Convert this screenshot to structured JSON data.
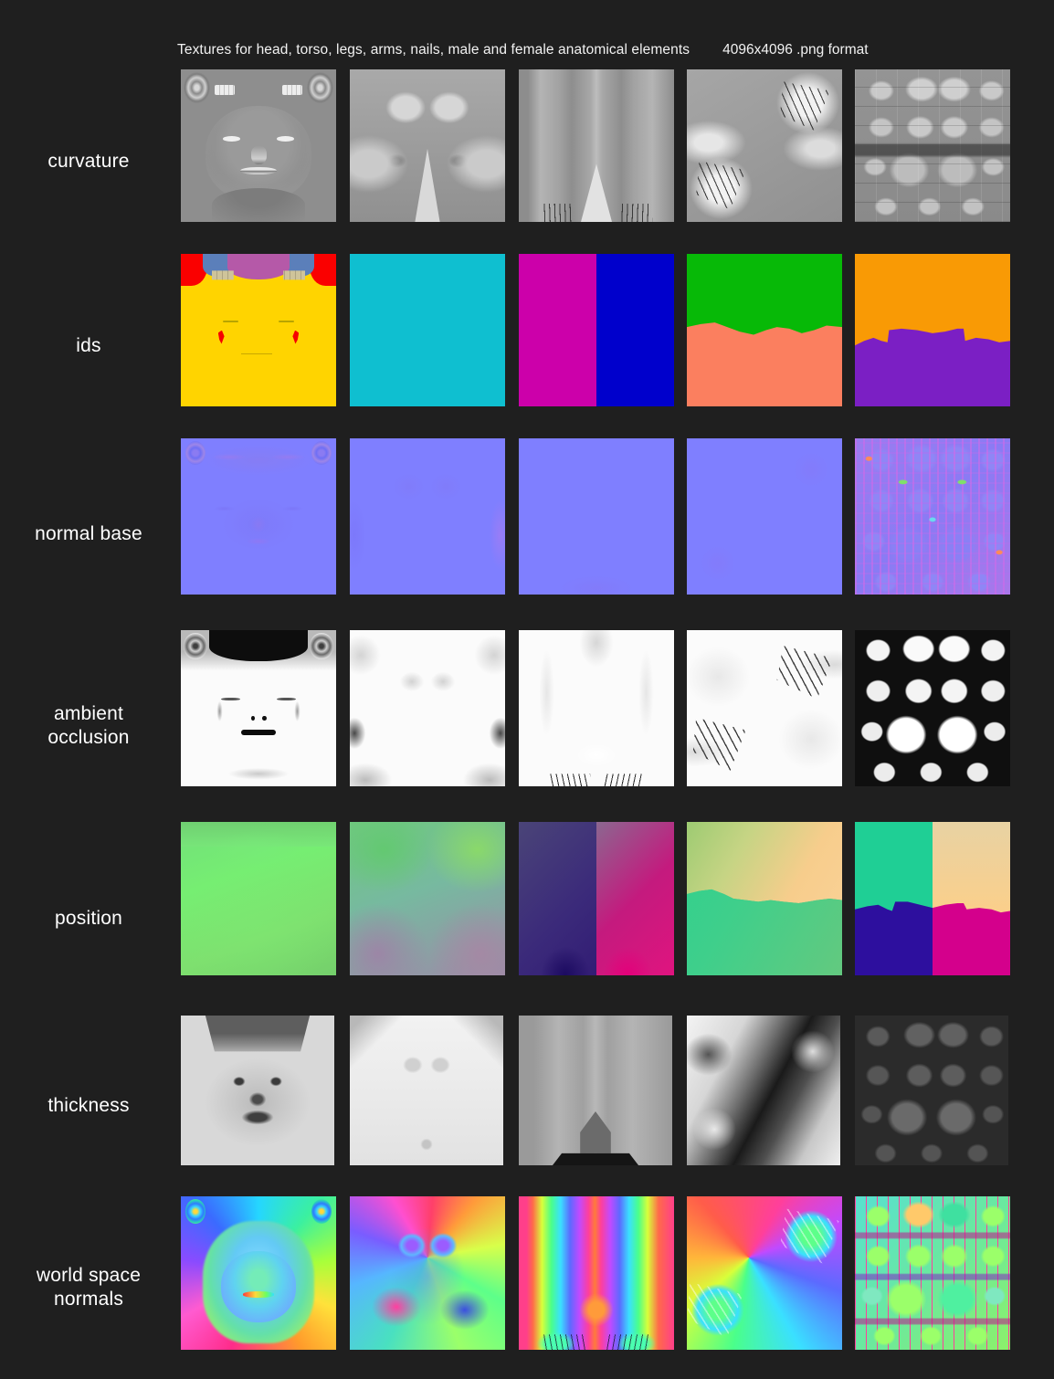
{
  "background_color": "#1f1f1f",
  "header": {
    "title": "Textures for head, torso, legs, arms, nails, male and female anatomical elements",
    "meta": "4096x4096 .png format"
  },
  "grid": {
    "column_subjects": [
      "head",
      "torso",
      "legs",
      "arms and hands",
      "nails"
    ],
    "rows": [
      {
        "label": "curvature",
        "kind": "grayscale-curvature",
        "thumbnails": [
          {
            "subject": "head",
            "description": "grayscale curvature map of a face with ears and teeth at top"
          },
          {
            "subject": "torso",
            "description": "grayscale curvature map of a female torso, mirrored"
          },
          {
            "subject": "legs",
            "description": "grayscale curvature map of mirrored legs"
          },
          {
            "subject": "arms and hands",
            "description": "grayscale curvature map of arms with splayed fingers"
          },
          {
            "subject": "nails",
            "description": "grayscale curvature map, grid of fingernails and toenails"
          }
        ]
      },
      {
        "label": "ids",
        "kind": "flat-color-id",
        "thumbnails": [
          {
            "subject": "head",
            "description": "yellow face with red, blue and purple id regions",
            "colors": [
              "#ffd400",
              "#fa0000",
              "#5b7fba",
              "#b559a8"
            ]
          },
          {
            "subject": "torso",
            "description": "solid cyan id region",
            "colors": [
              "#0fbfd0"
            ]
          },
          {
            "subject": "legs",
            "description": "magenta and blue split id regions",
            "colors": [
              "#cc00aa",
              "#0000cc"
            ]
          },
          {
            "subject": "arms and hands",
            "description": "green over salmon id regions",
            "colors": [
              "#07b907",
              "#fb7f5f"
            ]
          },
          {
            "subject": "nails",
            "description": "orange over purple id regions",
            "colors": [
              "#f99a05",
              "#7b1fc4"
            ]
          }
        ]
      },
      {
        "label": "normal base",
        "kind": "tangent-normal",
        "thumbnails": [
          {
            "subject": "head",
            "description": "flat lavender tangent normal map with faint face relief",
            "colors": [
              "#7f7fff"
            ]
          },
          {
            "subject": "torso",
            "description": "near-flat lavender tangent normal map",
            "colors": [
              "#7f7fff"
            ]
          },
          {
            "subject": "legs",
            "description": "near-flat lavender tangent normal map",
            "colors": [
              "#7f7fff"
            ]
          },
          {
            "subject": "arms and hands",
            "description": "near-flat lavender tangent normal map",
            "colors": [
              "#7f7fff"
            ]
          },
          {
            "subject": "nails",
            "description": "lavender and pink tangent normal map, grid of nails",
            "colors": [
              "#8f7ff0",
              "#d26ae8"
            ]
          }
        ]
      },
      {
        "label": "ambient\nocclusion",
        "label_lines": [
          "ambient",
          "occlusion"
        ],
        "kind": "grayscale-ao",
        "thumbnails": [
          {
            "subject": "head",
            "description": "white face with black occluded scalp, eyes and mouth"
          },
          {
            "subject": "torso",
            "description": "white torso with soft grey creases"
          },
          {
            "subject": "legs",
            "description": "white legs with dark toe occlusion"
          },
          {
            "subject": "arms and hands",
            "description": "white arms with dark finger occlusion"
          },
          {
            "subject": "nails",
            "description": "white nail grid with dark occlusion gaps"
          }
        ]
      },
      {
        "label": "position",
        "kind": "world-position",
        "thumbnails": [
          {
            "subject": "head",
            "description": "bright green world position gradient",
            "colors": [
              "#76ee72"
            ]
          },
          {
            "subject": "torso",
            "description": "green to mauve world position gradient",
            "colors": [
              "#6fc98a",
              "#9b87a8"
            ]
          },
          {
            "subject": "legs",
            "description": "purple-blue and magenta world position gradient",
            "colors": [
              "#3b2a7a",
              "#e0147f"
            ]
          },
          {
            "subject": "arms and hands",
            "description": "teal green and peach world position gradient",
            "colors": [
              "#23c98a",
              "#fbcf8a"
            ]
          },
          {
            "subject": "nails",
            "description": "teal, peach, indigo and magenta world position quadrants",
            "colors": [
              "#1fcf95",
              "#fbcf8a",
              "#2d0f9e",
              "#d4008c"
            ]
          }
        ]
      },
      {
        "label": "thickness",
        "kind": "grayscale-thickness",
        "thumbnails": [
          {
            "subject": "head",
            "description": "light grey face thickness with dark eyes, nose and mouth"
          },
          {
            "subject": "torso",
            "description": "near-white torso thickness map"
          },
          {
            "subject": "legs",
            "description": "mid grey legs thickness with dark lower region"
          },
          {
            "subject": "arms and hands",
            "description": "high contrast arms thickness, black and white"
          },
          {
            "subject": "nails",
            "description": "dark grey nail grid thickness map"
          }
        ]
      },
      {
        "label": "world space\nnormals",
        "label_lines": [
          "world space",
          "normals"
        ],
        "kind": "world-normal",
        "thumbnails": [
          {
            "subject": "head",
            "description": "rainbow world space normal map of a face"
          },
          {
            "subject": "torso",
            "description": "rainbow world space normal map of a female torso"
          },
          {
            "subject": "legs",
            "description": "rainbow world space normal map of mirrored legs and feet"
          },
          {
            "subject": "arms and hands",
            "description": "rainbow world space normal map of arms and hands"
          },
          {
            "subject": "nails",
            "description": "rainbow world space normal map, grid of nails"
          }
        ]
      }
    ]
  }
}
